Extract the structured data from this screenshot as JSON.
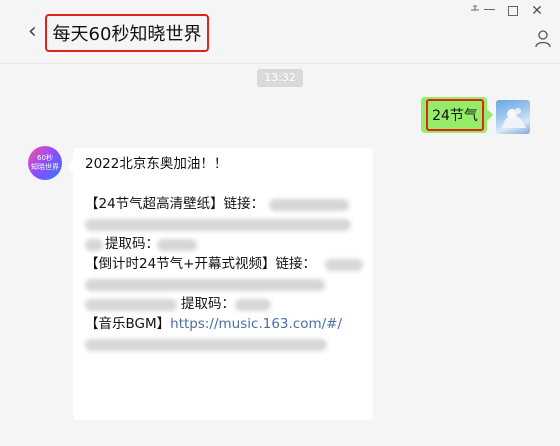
{
  "window": {
    "title": "每天60秒知晓世界",
    "back_icon": "chevron-left-icon",
    "controls": [
      "pin-icon",
      "minimize-icon",
      "maximize-icon",
      "close-icon"
    ],
    "profile_icon": "user-icon"
  },
  "chat": {
    "timestamp": "13:32",
    "outgoing": {
      "text": "24节气",
      "highlight_color": "#e2231a"
    },
    "incoming": {
      "avatar_text_1": "60秒",
      "avatar_text_2": "知晓世界",
      "line_1": "2022北京东奥加油！！",
      "line_2": "【24节气超高清壁纸】链接：",
      "line_3_label": "提取码：",
      "line_4": "【倒计时24节气+开幕式视频】链接：",
      "line_5_label": "提取码：",
      "line_6_label": "【音乐BGM】",
      "line_6_link": "https://music.163.com/#/"
    }
  },
  "colors": {
    "background": "#f5f5f5",
    "outgoing_bubble": "#95ec69",
    "incoming_bubble": "#ffffff",
    "link": "#4a6fa5",
    "highlight": "#e2231a"
  }
}
